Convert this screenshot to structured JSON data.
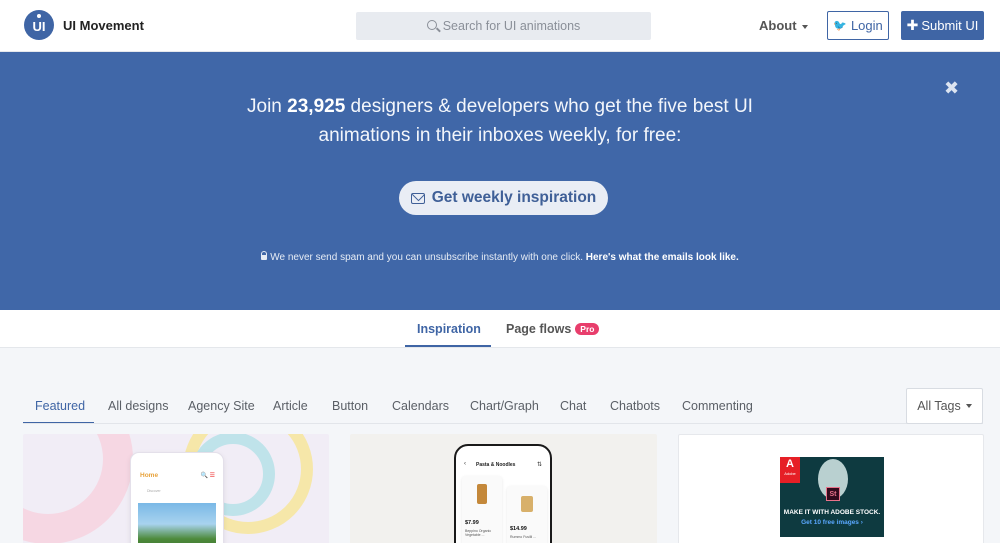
{
  "header": {
    "logo_text": "UI",
    "brand": "UI Movement",
    "search_placeholder": "Search for UI animations",
    "about_label": "About",
    "login_label": "Login",
    "submit_label": "Submit UI"
  },
  "banner": {
    "headline_pre": "Join ",
    "headline_count": "23,925",
    "headline_post": " designers & developers who get the five best UI animations in their inboxes weekly, for free:",
    "cta_label": "Get weekly inspiration",
    "note_text": "We never send spam and you can unsubscribe instantly with one click. ",
    "note_link": "Here's what the emails look like.",
    "close_symbol": "✖"
  },
  "tabs": [
    {
      "label": "Inspiration",
      "active": true
    },
    {
      "label": "Page flows",
      "badge": "Pro",
      "active": false
    }
  ],
  "categories": [
    "Featured",
    "All designs",
    "Agency Site",
    "Article",
    "Button",
    "Calendars",
    "Chart/Graph",
    "Chat",
    "Chatbots",
    "Commenting"
  ],
  "all_tags_label": "All Tags",
  "cards": {
    "card1": {
      "screen_title": "Home",
      "screen_icons": "🔍 ☰",
      "screen_sub": "Discover"
    },
    "card2": {
      "screen_title": "Pasta & Noodles",
      "back": "‹",
      "filter": "⇅",
      "item1_price": "$7.99",
      "item1_desc": "Beppino Organic Vegetable ...",
      "item2_price": "$14.99",
      "item2_desc": "Rummo Fusilli ..."
    },
    "card3": {
      "ad_brand": "A",
      "ad_brand_sub": "Adobe",
      "ad_product": "St",
      "ad_headline": "MAKE IT WITH ADOBE STOCK.",
      "ad_link": "Get 10 free images ›"
    }
  },
  "colors": {
    "brand_blue": "#3f65a5",
    "banner_blue": "#4067a8",
    "pro_badge": "#e83e6c"
  },
  "icons": {
    "search": "search-icon",
    "twitter": "twitter-icon",
    "plus": "plus-icon",
    "envelope": "envelope-icon",
    "lock": "lock-icon",
    "close": "close-icon",
    "caret": "caret-down-icon"
  }
}
